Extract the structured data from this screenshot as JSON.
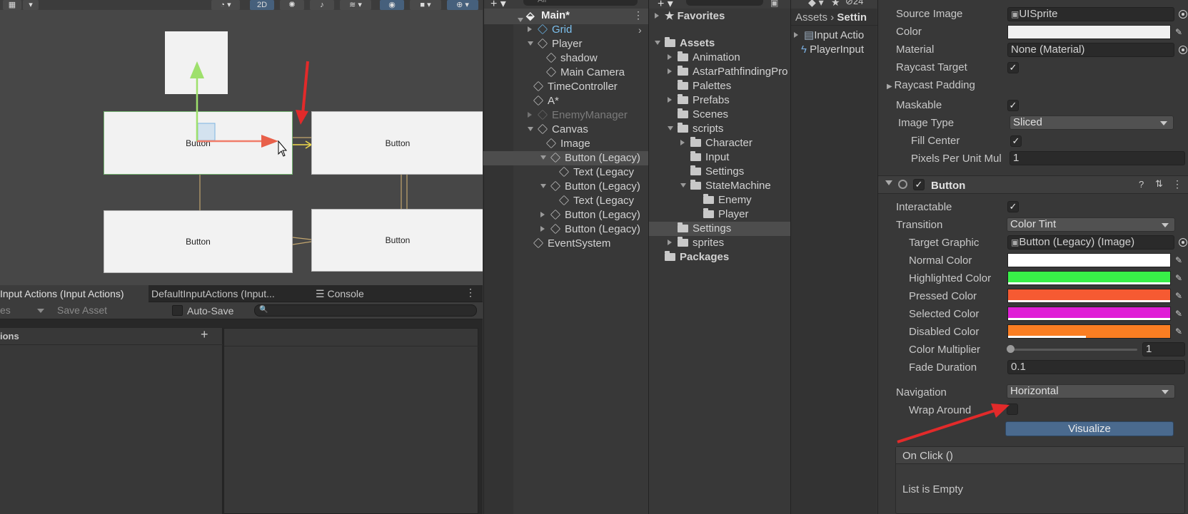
{
  "scene": {
    "toolbar": {
      "mode_2d": "2D"
    },
    "buttons": [
      "Button",
      "Button",
      "Button",
      "Button"
    ]
  },
  "bottom_tabs": {
    "tab1": "Input Actions (Input Actions)",
    "tab2": "DefaultInputActions (Input...",
    "tab3": "Console"
  },
  "input_actions": {
    "save_asset": "Save Asset",
    "auto_save": "Auto-Save",
    "partial_left": "es",
    "actions_header": "ions",
    "add": "+"
  },
  "hierarchy": {
    "search_placeholder": "All",
    "scene_name": "Main*",
    "items": [
      "Grid",
      "Player",
      "shadow",
      "Main Camera",
      "TimeController",
      "A*",
      "EnemyManager",
      "Canvas",
      "Image",
      "Button (Legacy)",
      "Text (Legacy",
      "Button (Legacy)",
      "Text (Legacy",
      "Button (Legacy)",
      "Button (Legacy)",
      "EventSystem"
    ]
  },
  "project": {
    "favorites": "Favorites",
    "assets": "Assets",
    "folders": [
      "Animation",
      "AstarPathfindingPro",
      "Palettes",
      "Prefabs",
      "Scenes",
      "scripts",
      "Character",
      "Input",
      "Settings",
      "StateMachine",
      "Enemy",
      "Player",
      "Settings",
      "sprites"
    ],
    "packages": "Packages",
    "breadcrumb_root": "Assets",
    "breadcrumb_current": "Settin",
    "content_items": [
      "Input Actio",
      "PlayerInput"
    ],
    "count_badge": "24"
  },
  "inspector": {
    "image": {
      "source_image_label": "Source Image",
      "source_image_value": "UISprite",
      "color_label": "Color",
      "material_label": "Material",
      "material_value": "None (Material)",
      "raycast_target_label": "Raycast Target",
      "raycast_padding_label": "Raycast Padding",
      "maskable_label": "Maskable",
      "image_type_label": "Image Type",
      "image_type_value": "Sliced",
      "fill_center_label": "Fill Center",
      "ppu_label": "Pixels Per Unit Mul",
      "ppu_value": "1"
    },
    "button": {
      "title": "Button",
      "interactable_label": "Interactable",
      "transition_label": "Transition",
      "transition_value": "Color Tint",
      "target_graphic_label": "Target Graphic",
      "target_graphic_value": "Button (Legacy) (Image)",
      "normal_color_label": "Normal Color",
      "highlighted_color_label": "Highlighted Color",
      "pressed_color_label": "Pressed Color",
      "selected_color_label": "Selected Color",
      "disabled_color_label": "Disabled Color",
      "color_multiplier_label": "Color Multiplier",
      "color_multiplier_value": "1",
      "fade_duration_label": "Fade Duration",
      "fade_duration_value": "0.1",
      "navigation_label": "Navigation",
      "navigation_value": "Horizontal",
      "wrap_around_label": "Wrap Around",
      "visualize_label": "Visualize",
      "onclick_label": "On Click ()",
      "list_empty": "List is Empty"
    },
    "colors": {
      "white": "#f0f0f0",
      "normal": "#ffffff",
      "highlighted": "#38f048",
      "pressed": "#f65a32",
      "selected": "#e01ed6",
      "disabled": "#fb7e22"
    }
  }
}
